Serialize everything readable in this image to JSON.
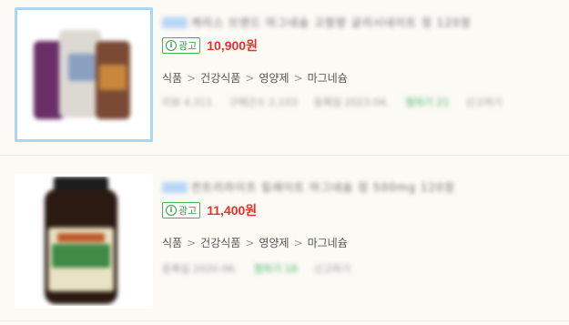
{
  "listings": [
    {
      "title": "캐리스 브랜드 마그네슘 고함량 글리시네이트 정 120정",
      "ad_label": "광고",
      "price": "10,900원",
      "breadcrumb": [
        "식품",
        "건강식품",
        "영양제",
        "마그네슘"
      ],
      "meta": [
        "리뷰 4,311",
        "구매건수 2,103",
        "등록일 2023.04.",
        "찜하기 21",
        "신고하기"
      ]
    },
    {
      "title": "컨트리라이프 킬레이트 마그네슘 정 500mg 120정",
      "ad_label": "광고",
      "price": "11,400원",
      "breadcrumb": [
        "식품",
        "건강식품",
        "영양제",
        "마그네슘"
      ],
      "meta": [
        "등록일 2020.06.",
        "찜하기 18",
        "신고하기"
      ]
    }
  ],
  "colors": {
    "price": "#e6322b",
    "ad_green": "#2e9e47",
    "selected_border": "#a9d6f3"
  },
  "icons": [
    "info-icon"
  ]
}
